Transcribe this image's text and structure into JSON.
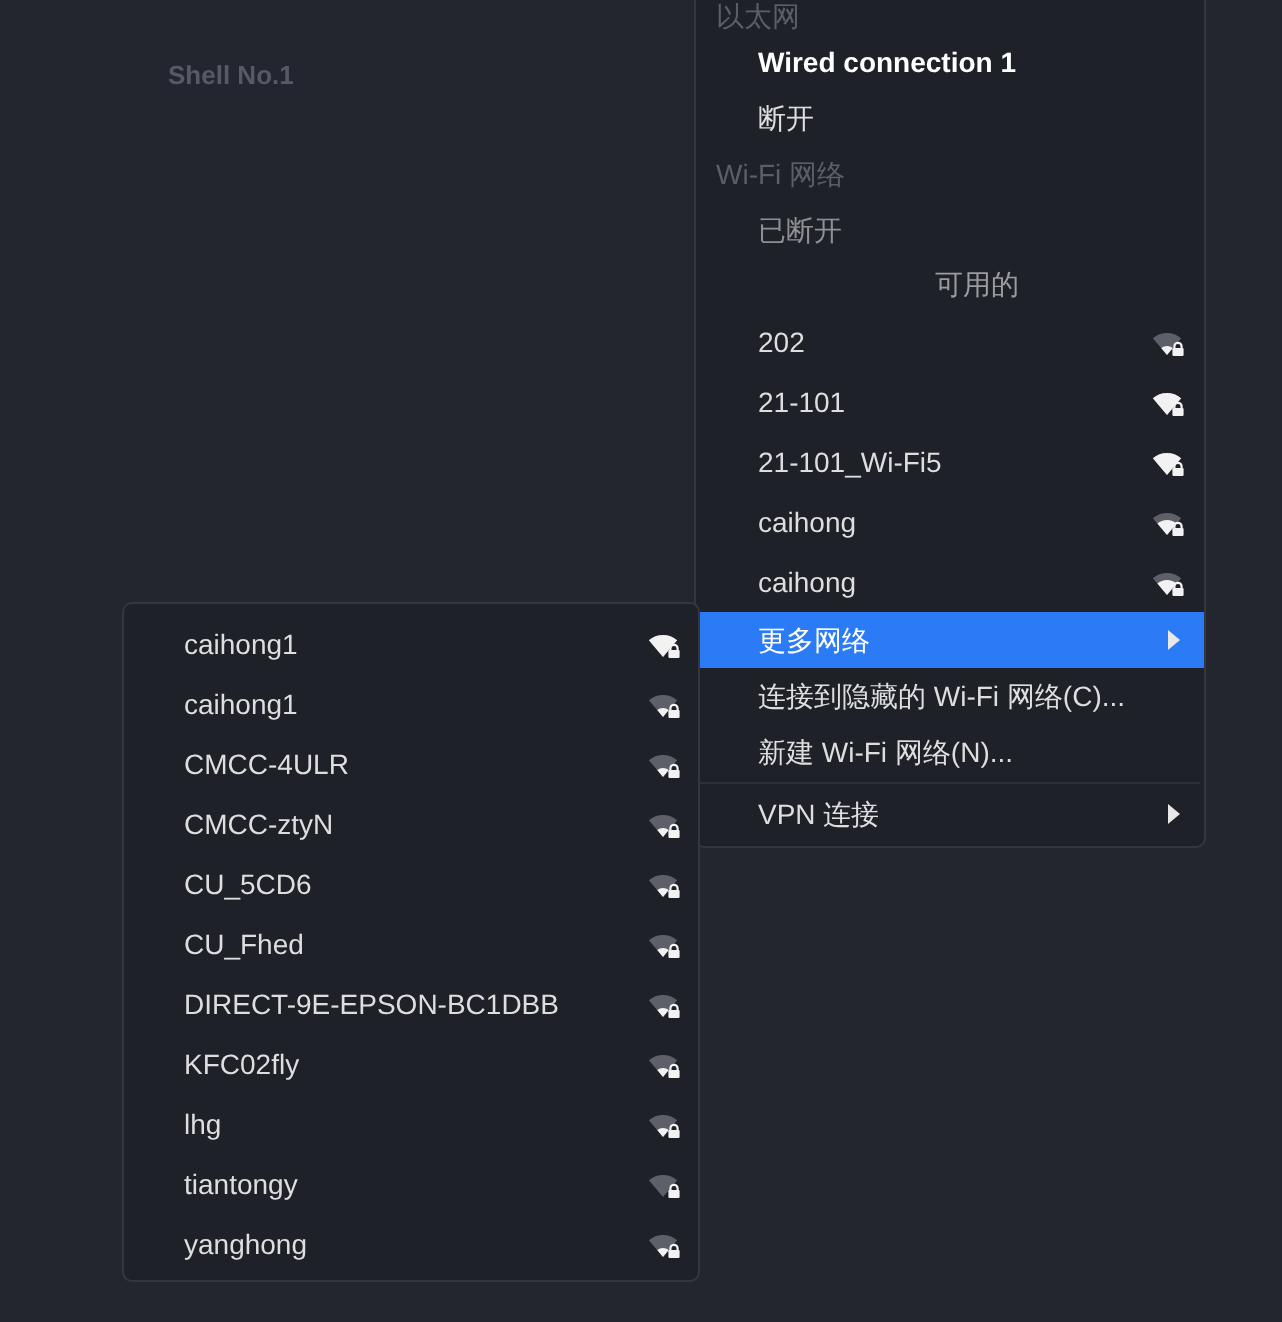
{
  "desktop": {
    "label": "Shell No.1"
  },
  "menu": {
    "items": [
      {
        "kind": "header",
        "label": "以太网"
      },
      {
        "kind": "item",
        "label": "Wired connection 1",
        "active": true,
        "disabled": false,
        "selected": false
      },
      {
        "kind": "item",
        "label": "断开",
        "active": false,
        "disabled": false,
        "selected": false
      },
      {
        "kind": "header",
        "label": "Wi-Fi 网络"
      },
      {
        "kind": "item",
        "label": "已断开",
        "active": false,
        "disabled": true,
        "selected": false
      },
      {
        "kind": "section",
        "label": "可用的"
      },
      {
        "kind": "network",
        "label": "202",
        "icon": {
          "kind": "low"
        },
        "selected": false
      },
      {
        "kind": "network",
        "label": "21-101",
        "icon": {
          "kind": "full"
        },
        "selected": false
      },
      {
        "kind": "network",
        "label": "21-101_Wi-Fi5",
        "icon": {
          "kind": "full"
        },
        "selected": false
      },
      {
        "kind": "network",
        "label": "caihong",
        "icon": {
          "kind": "high"
        },
        "selected": false
      },
      {
        "kind": "network",
        "label": "caihong",
        "icon": {
          "kind": "high"
        },
        "selected": false
      },
      {
        "kind": "submenu",
        "label": "更多网络",
        "selected": true
      },
      {
        "kind": "item",
        "label": "连接到隐藏的 Wi-Fi 网络(C)...",
        "active": false,
        "disabled": false,
        "selected": false
      },
      {
        "kind": "item",
        "label": "新建 Wi-Fi 网络(N)...",
        "active": false,
        "disabled": false,
        "selected": false
      },
      {
        "kind": "separator"
      },
      {
        "kind": "submenu",
        "label": "VPN 连接",
        "selected": false
      }
    ]
  },
  "submenu": {
    "networks": [
      {
        "label": "caihong1",
        "icon": {
          "kind": "full"
        },
        "selected": false
      },
      {
        "label": "caihong1",
        "icon": {
          "kind": "low"
        },
        "selected": false
      },
      {
        "label": "CMCC-4ULR",
        "icon": {
          "kind": "low"
        },
        "selected": false
      },
      {
        "label": "CMCC-ztyN",
        "icon": {
          "kind": "low"
        },
        "selected": false
      },
      {
        "label": "CU_5CD6",
        "icon": {
          "kind": "low"
        },
        "selected": false
      },
      {
        "label": "CU_Fhed",
        "icon": {
          "kind": "low"
        },
        "selected": false
      },
      {
        "label": "DIRECT-9E-EPSON-BC1DBB",
        "icon": {
          "kind": "low"
        },
        "selected": false
      },
      {
        "label": "KFC02fly",
        "icon": {
          "kind": "low"
        },
        "selected": false
      },
      {
        "label": "lhg",
        "icon": {
          "kind": "low"
        },
        "selected": false
      },
      {
        "label": "tiantongy",
        "icon": {
          "kind": "none"
        },
        "selected": false
      },
      {
        "label": "yanghong",
        "icon": {
          "kind": "low"
        },
        "selected": false
      }
    ]
  }
}
